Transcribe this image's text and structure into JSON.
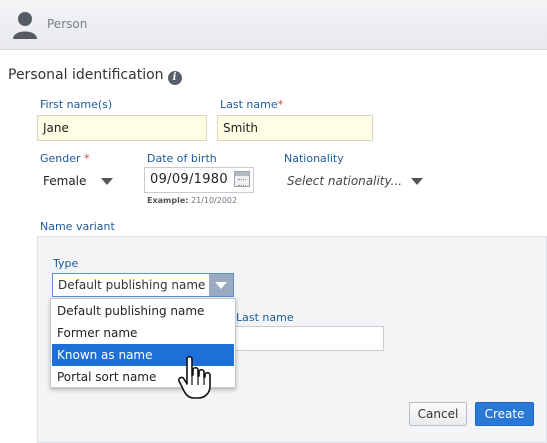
{
  "header": {
    "title": "Person",
    "icon": "person-icon"
  },
  "section": {
    "title": "Personal identification",
    "info_icon": "i"
  },
  "form": {
    "first_name": {
      "label": "First name(s)",
      "value": "Jane"
    },
    "last_name": {
      "label": "Last name",
      "required_mark": "*",
      "value": "Smith"
    },
    "gender": {
      "label": "Gender",
      "required_mark": "*",
      "value": "Female"
    },
    "dob": {
      "label": "Date of birth",
      "value": "09/09/1980",
      "hint_prefix": "Example:",
      "hint_value": "21/10/2002"
    },
    "nationality": {
      "label": "Nationality",
      "placeholder": "Select nationality..."
    }
  },
  "name_variant": {
    "label": "Name variant",
    "type_label": "Type",
    "type_value": "Default publishing name",
    "last_name_label": "Last name",
    "options": [
      {
        "label": "Default publishing name",
        "selected": false
      },
      {
        "label": "Former name",
        "selected": false
      },
      {
        "label": "Known as name",
        "selected": true
      },
      {
        "label": "Portal sort name",
        "selected": false
      }
    ]
  },
  "buttons": {
    "cancel": "Cancel",
    "create": "Create"
  },
  "colors": {
    "accent": "#2a78d6",
    "label_blue": "#1d5a99",
    "required": "#e03a3a",
    "input_highlight": "#fffde3"
  }
}
